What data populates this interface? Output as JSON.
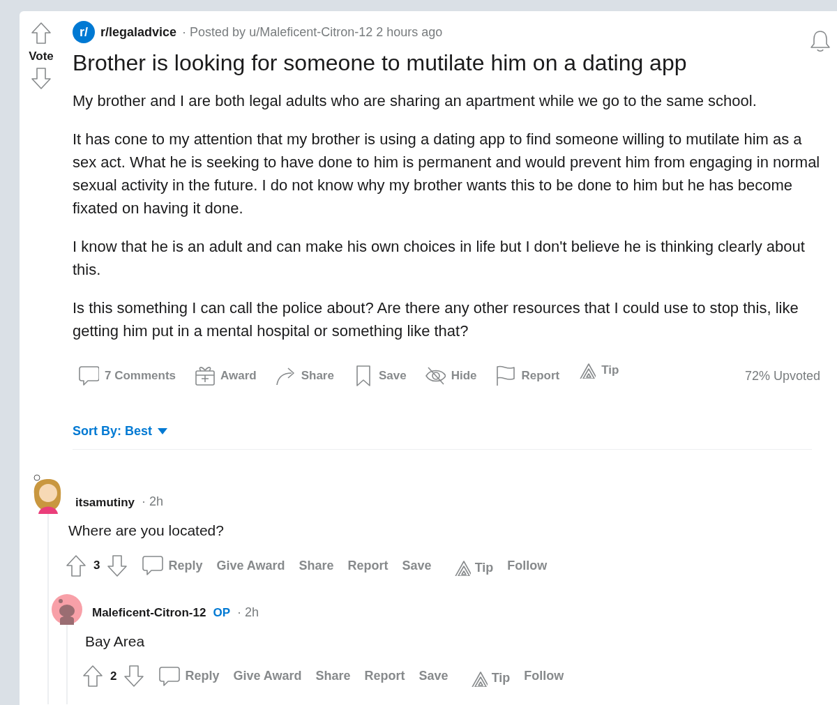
{
  "post": {
    "vote_label": "Vote",
    "subreddit": "r/legaladvice",
    "subreddit_icon": "r/",
    "meta": "· Posted by u/Maleficent-Citron-12 2 hours ago",
    "title": "Brother is looking for someone to mutilate him on a dating app",
    "paragraphs": [
      "My brother and I are both legal adults who are sharing an apartment while we go to the same school.",
      "It has cone to my attention that my brother is using a dating app to find someone willing to mutilate him as a sex act. What he is seeking to have done to him is permanent and would prevent him from engaging in normal sexual activity in the future. I do not know why my brother wants this to be done to him but he has become fixated on having it done.",
      "I know that he is an adult and can make his own choices in life but I don't believe he is thinking clearly about this.",
      "Is this something I can call the police about? Are there any other resources that I could use to stop this, like getting him put in a mental hospital or something like that?"
    ],
    "actions": [
      {
        "kind": "comment",
        "label": "7 Comments"
      },
      {
        "kind": "gift",
        "label": "Award"
      },
      {
        "kind": "share",
        "label": "Share"
      },
      {
        "kind": "bookmark",
        "label": "Save"
      },
      {
        "kind": "hide",
        "label": "Hide"
      },
      {
        "kind": "flag",
        "label": "Report"
      },
      {
        "kind": "tip",
        "label": "Tip"
      }
    ],
    "upvoted": "72% Upvoted"
  },
  "sort": {
    "label": "Sort By: Best"
  },
  "comments": [
    {
      "author": "itsamutiny",
      "kind": "custom",
      "time": "· 2h",
      "body": "Where are you located?",
      "score": "3",
      "actions": [
        "Reply",
        "Give Award",
        "Share",
        "Report",
        "Save",
        "Tip",
        "Follow"
      ],
      "children": [
        {
          "author": "Maleficent-Citron-12",
          "kind": "default",
          "op_label": "OP",
          "time": "· 2h",
          "body": "Bay Area",
          "score": "2",
          "actions": [
            "Reply",
            "Give Award",
            "Share",
            "Report",
            "Save",
            "Tip",
            "Follow"
          ]
        }
      ]
    }
  ]
}
